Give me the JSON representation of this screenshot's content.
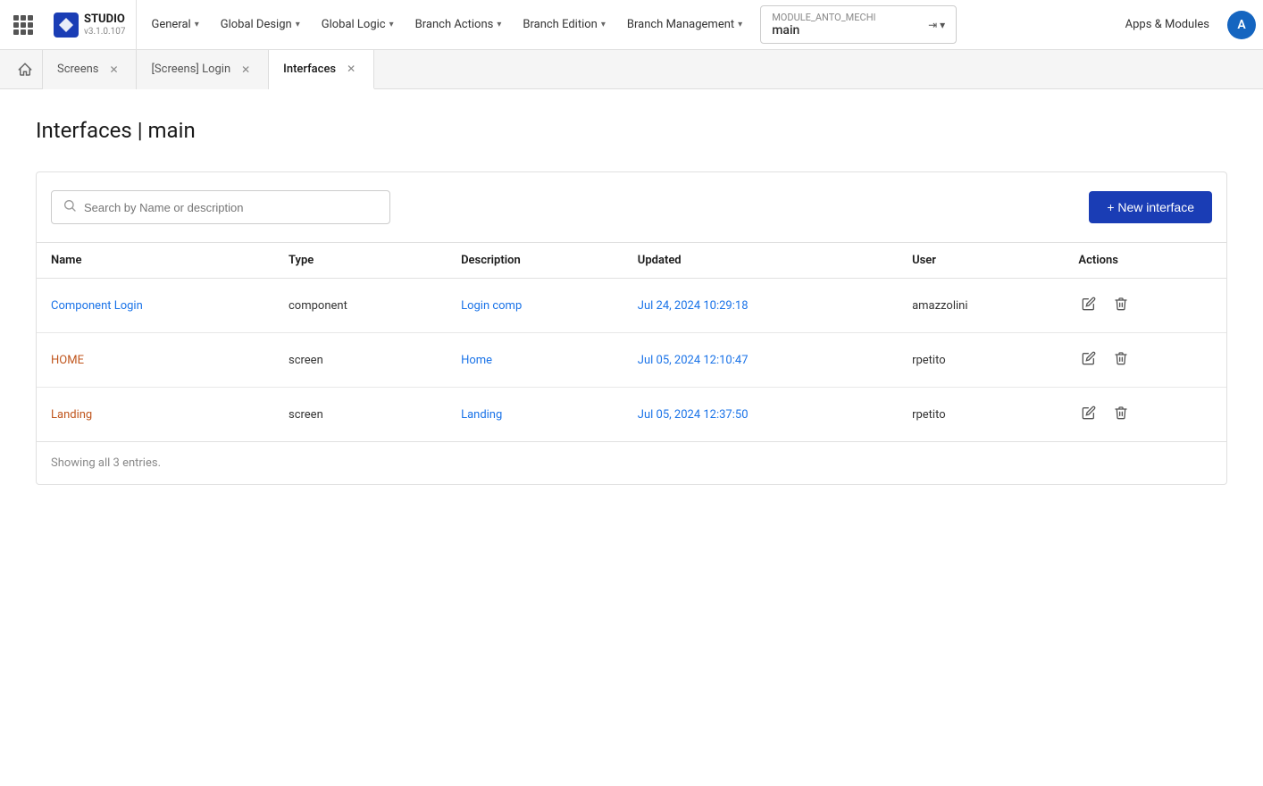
{
  "app": {
    "studio_label": "STUDIO",
    "studio_version": "v3.1.0.107"
  },
  "nav": {
    "general_label": "General",
    "global_design_label": "Global Design",
    "global_logic_label": "Global Logic",
    "branch_actions_label": "Branch Actions",
    "branch_edition_label": "Branch Edition",
    "branch_management_label": "Branch Management",
    "module_name": "MODULE_ANTO_MECHI",
    "module_branch": "main",
    "apps_modules_label": "Apps & Modules",
    "user_initial": "A"
  },
  "tabs": [
    {
      "label": "Screens",
      "active": false
    },
    {
      "label": "[Screens] Login",
      "active": false
    },
    {
      "label": "Interfaces",
      "active": true
    }
  ],
  "page": {
    "title": "Interfaces | main"
  },
  "toolbar": {
    "search_placeholder": "Search by Name or description",
    "new_interface_label": "+ New interface"
  },
  "table": {
    "columns": [
      "Name",
      "Type",
      "Description",
      "Updated",
      "User",
      "Actions"
    ],
    "rows": [
      {
        "name": "Component Login",
        "type": "component",
        "description": "Login comp",
        "updated": "Jul 24, 2024 10:29:18",
        "user": "amazzolini"
      },
      {
        "name": "HOME",
        "type": "screen",
        "description": "Home",
        "updated": "Jul 05, 2024 12:10:47",
        "user": "rpetito"
      },
      {
        "name": "Landing",
        "type": "screen",
        "description": "Landing",
        "updated": "Jul 05, 2024 12:37:50",
        "user": "rpetito"
      }
    ],
    "footer": "Showing all 3 entries."
  }
}
